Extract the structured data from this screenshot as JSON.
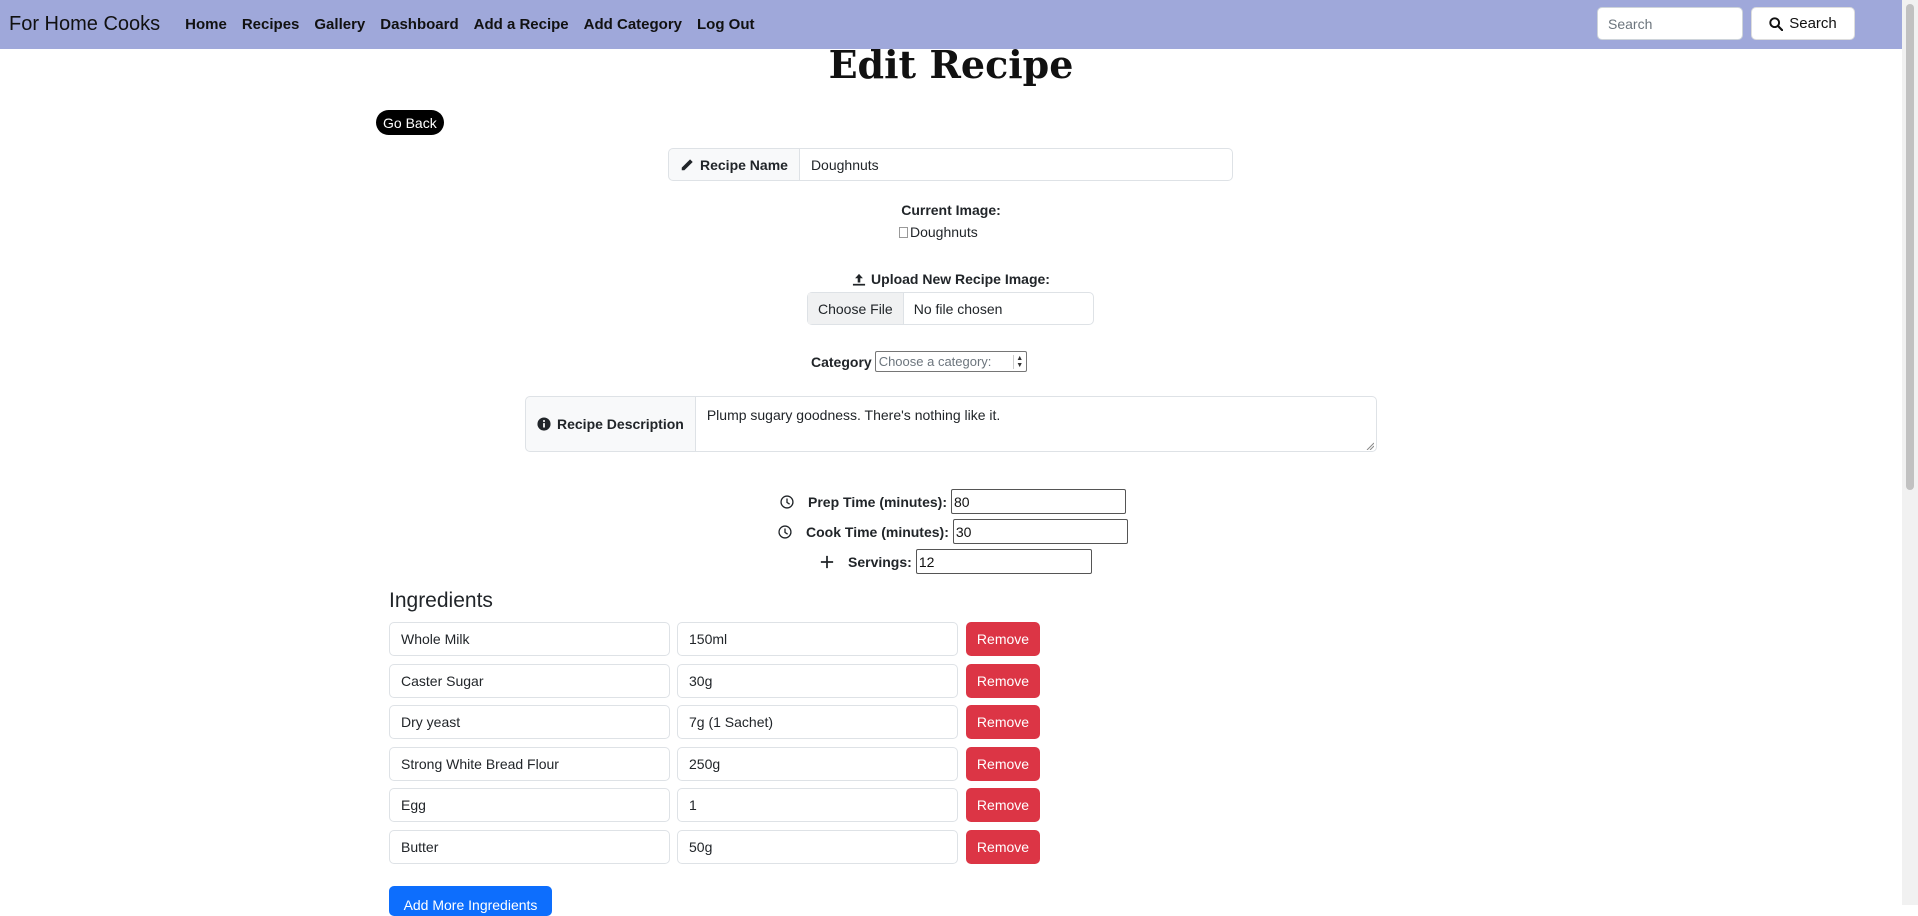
{
  "nav": {
    "brand": "For Home Cooks",
    "links": [
      "Home",
      "Recipes",
      "Gallery",
      "Dashboard",
      "Add a Recipe",
      "Add Category",
      "Log Out"
    ],
    "search_placeholder": "Search",
    "search_button": "Search"
  },
  "page": {
    "title": "Edit Recipe",
    "go_back": "Go Back"
  },
  "form": {
    "recipe_name_label": "Recipe Name",
    "recipe_name_value": "Doughnuts",
    "current_image_label": "Current Image:",
    "current_image_alt": "Doughnuts",
    "upload_label": "Upload New Recipe Image:",
    "file_button": "Choose File",
    "file_status": "No file chosen",
    "category_label": "Category",
    "category_placeholder": "Choose a category:",
    "description_label": "Recipe Description",
    "description_value": "Plump sugary goodness. There's nothing like it.",
    "prep_label": "Prep Time (minutes):",
    "prep_value": "80",
    "cook_label": "Cook Time (minutes):",
    "cook_value": "30",
    "servings_label": "Servings:",
    "servings_value": "12"
  },
  "ingredients": {
    "heading": "Ingredients",
    "remove_label": "Remove",
    "items": [
      {
        "name": "Whole Milk",
        "quantity": "150ml"
      },
      {
        "name": "Caster Sugar",
        "quantity": "30g"
      },
      {
        "name": "Dry yeast",
        "quantity": "7g (1 Sachet)"
      },
      {
        "name": "Strong White Bread Flour",
        "quantity": "250g"
      },
      {
        "name": "Egg",
        "quantity": "1"
      },
      {
        "name": "Butter",
        "quantity": "50g"
      }
    ],
    "add_more": "Add More Ingredients"
  },
  "colors": {
    "navbar_bg": "#9fa8da",
    "remove_btn": "#dc3545",
    "primary_btn": "#0d6efd"
  }
}
